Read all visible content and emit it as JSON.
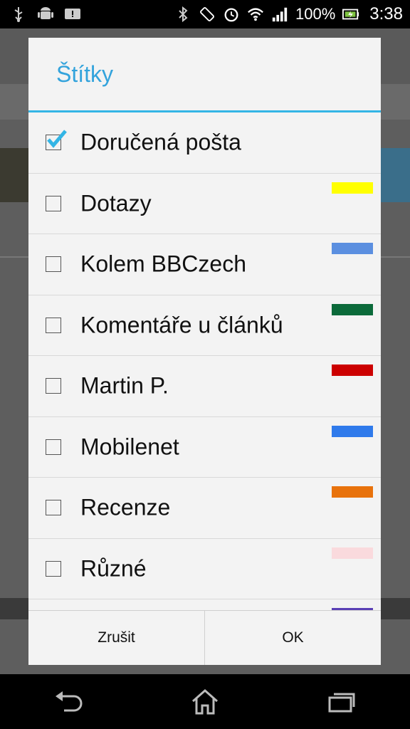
{
  "status_bar": {
    "battery_percent": "100%",
    "time": "3:38",
    "icons": [
      "usb-icon",
      "android-icon",
      "notification-icon",
      "bluetooth-icon",
      "rotation-icon",
      "alarm-icon",
      "wifi-icon",
      "signal-icon",
      "battery-icon"
    ]
  },
  "dialog": {
    "title": "Štítky",
    "labels": [
      {
        "name": "Doručená pošta",
        "checked": true,
        "color": null
      },
      {
        "name": "Dotazy",
        "checked": false,
        "color": "#ffff00"
      },
      {
        "name": "Kolem BBCzech",
        "checked": false,
        "color": "#5b8fe0"
      },
      {
        "name": "Komentáře u článků",
        "checked": false,
        "color": "#0b6a3a"
      },
      {
        "name": "Martin P.",
        "checked": false,
        "color": "#cc0000"
      },
      {
        "name": "Mobilenet",
        "checked": false,
        "color": "#2f7aeb"
      },
      {
        "name": "Recenze",
        "checked": false,
        "color": "#e8720c"
      },
      {
        "name": "Různé",
        "checked": false,
        "color": "#fadadd"
      },
      {
        "name": "",
        "checked": false,
        "color": "#5a3fb5"
      }
    ],
    "cancel_label": "Zrušit",
    "ok_label": "OK"
  },
  "nav_bar": {
    "icons": [
      "back-icon",
      "home-icon",
      "recent-apps-icon"
    ]
  }
}
